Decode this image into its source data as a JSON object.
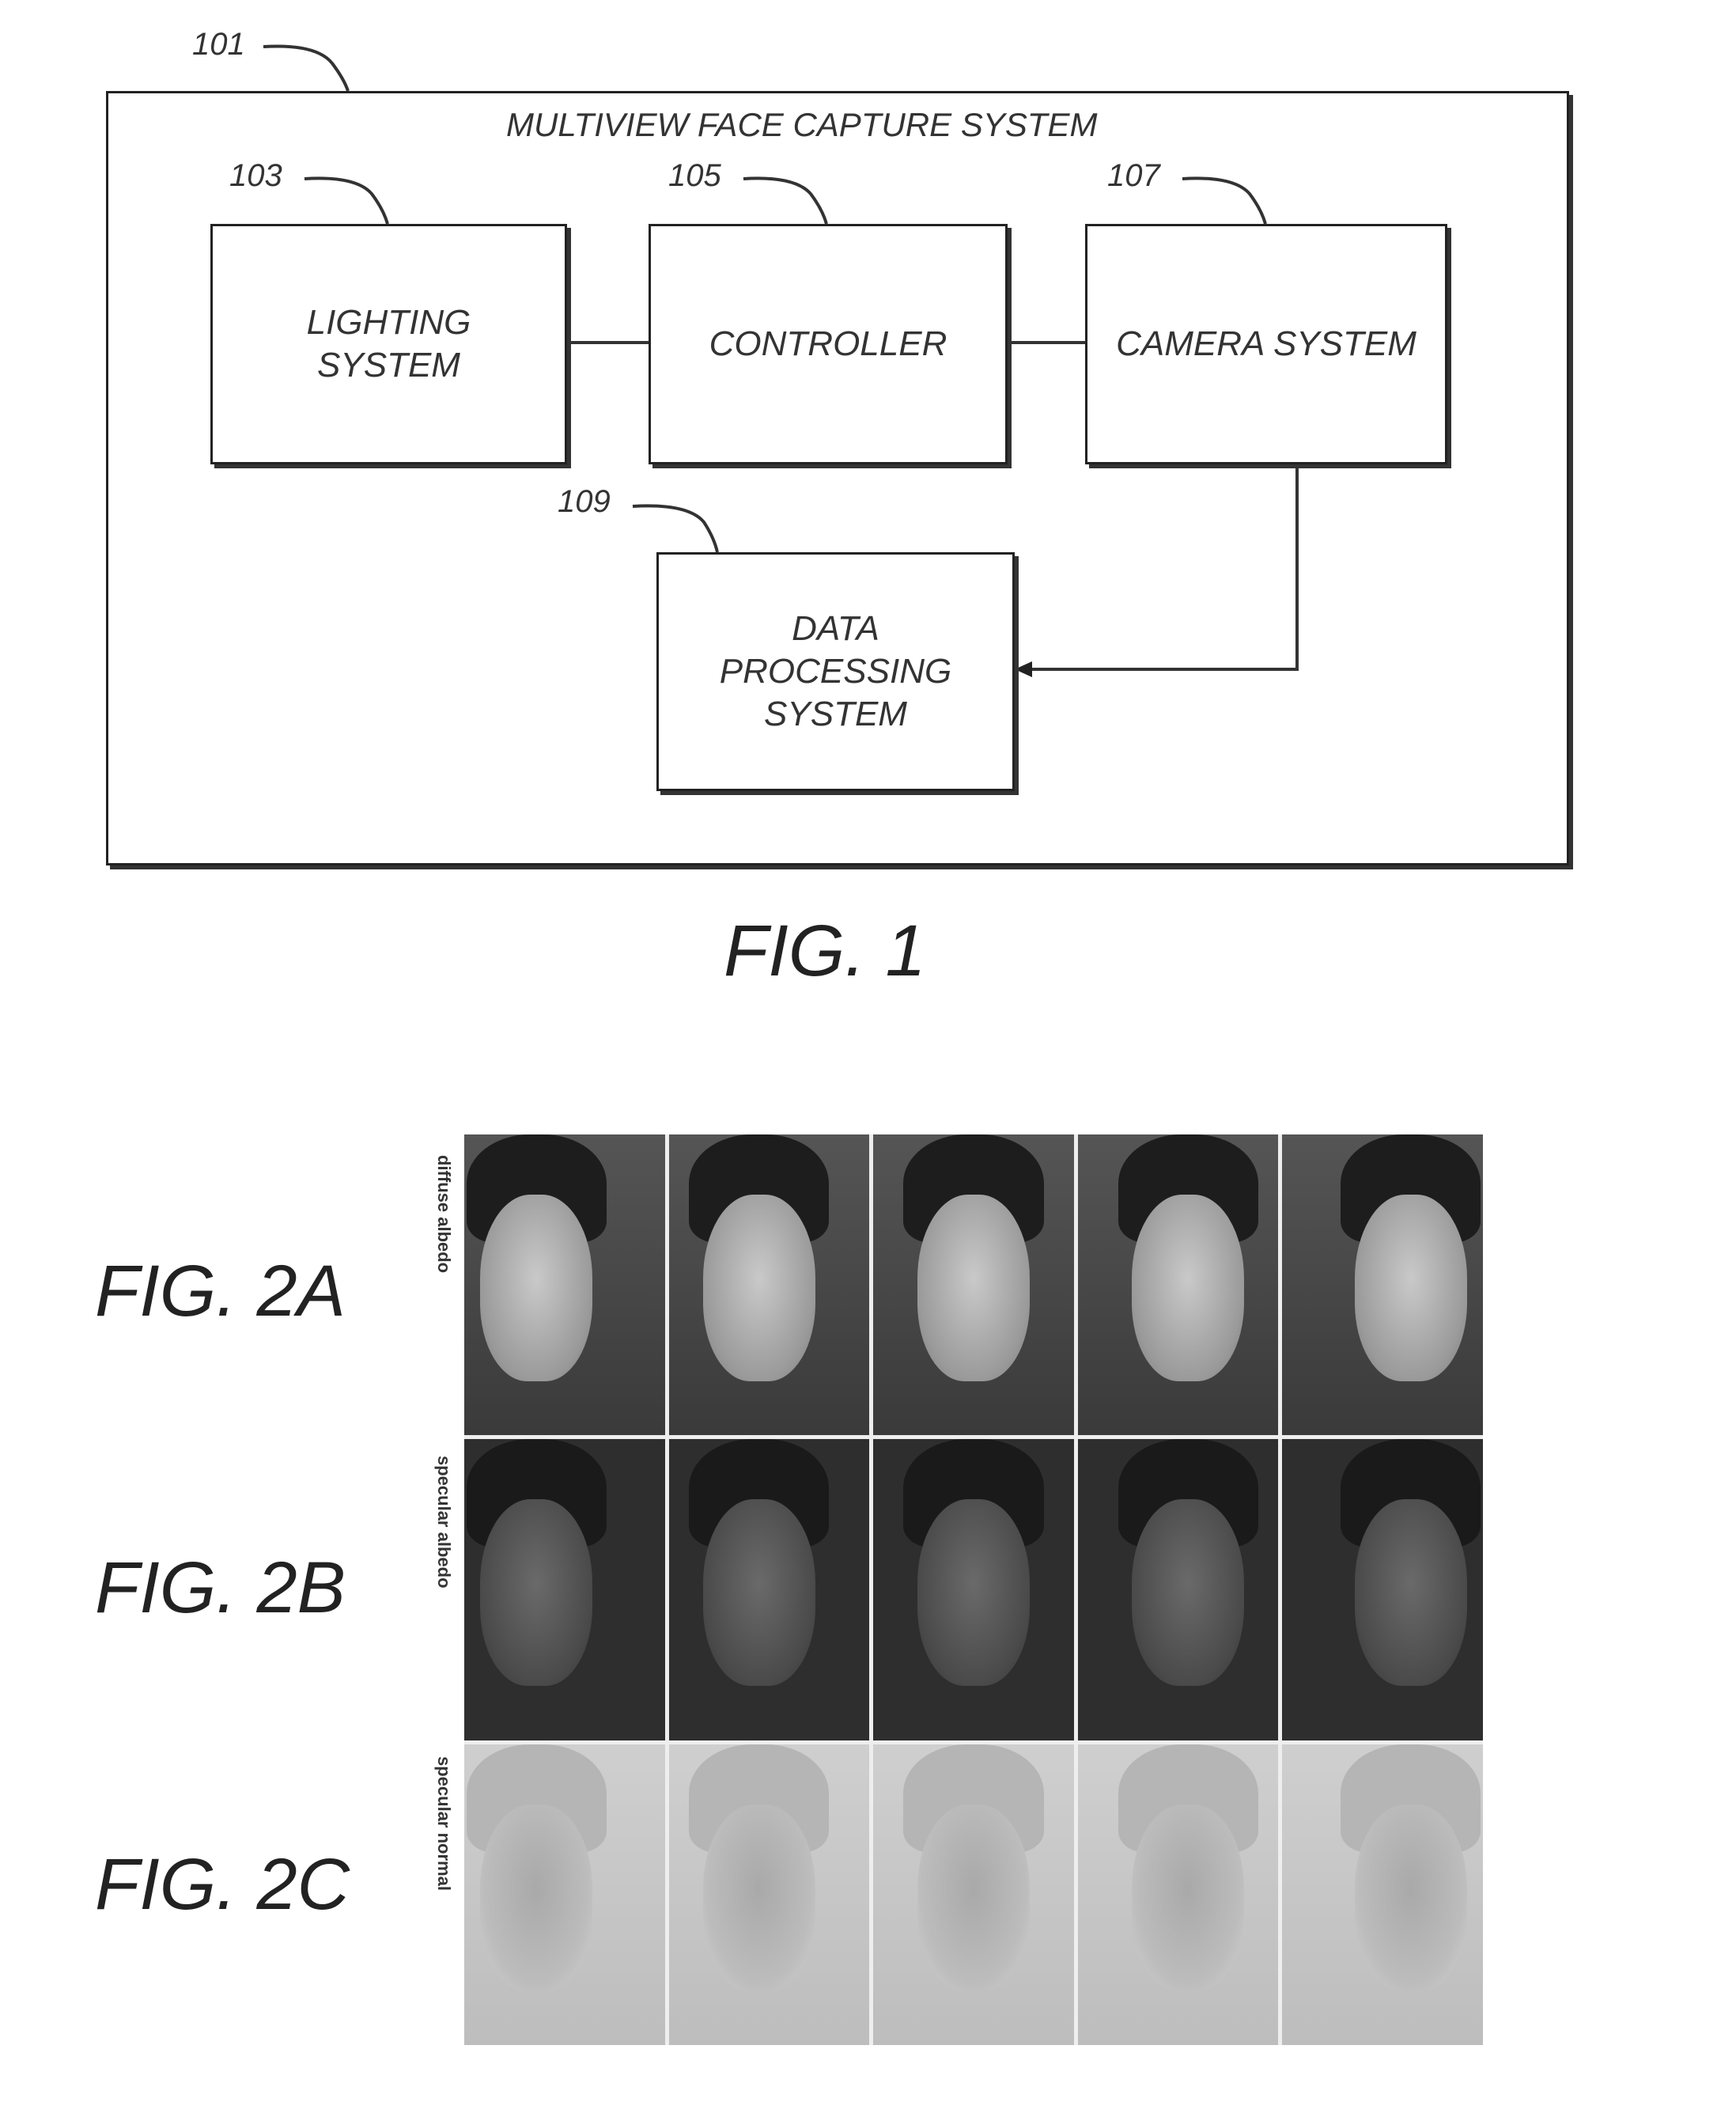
{
  "fig1": {
    "system_ref": "101",
    "system_title": "MULTIVIEW FACE CAPTURE SYSTEM",
    "blocks": [
      {
        "ref": "103",
        "label_lines": [
          "LIGHTING",
          "SYSTEM"
        ]
      },
      {
        "ref": "105",
        "label_lines": [
          "CONTROLLER"
        ]
      },
      {
        "ref": "107",
        "label_lines": [
          "CAMERA SYSTEM"
        ]
      },
      {
        "ref": "109",
        "label_lines": [
          "DATA",
          "PROCESSING",
          "SYSTEM"
        ]
      }
    ],
    "connections": [
      {
        "from": "LIGHTING SYSTEM",
        "to": "CONTROLLER",
        "type": "line"
      },
      {
        "from": "CONTROLLER",
        "to": "CAMERA SYSTEM",
        "type": "line"
      },
      {
        "from": "CAMERA SYSTEM",
        "to": "DATA PROCESSING SYSTEM",
        "type": "arrow"
      }
    ],
    "caption": "FIG. 1"
  },
  "fig2": {
    "rows": [
      {
        "caption": "FIG. 2A",
        "side_label": "diffuse albedo"
      },
      {
        "caption": "FIG. 2B",
        "side_label": "specular albedo"
      },
      {
        "caption": "FIG. 2C",
        "side_label": "specular normal"
      }
    ],
    "views_per_row": 5
  }
}
